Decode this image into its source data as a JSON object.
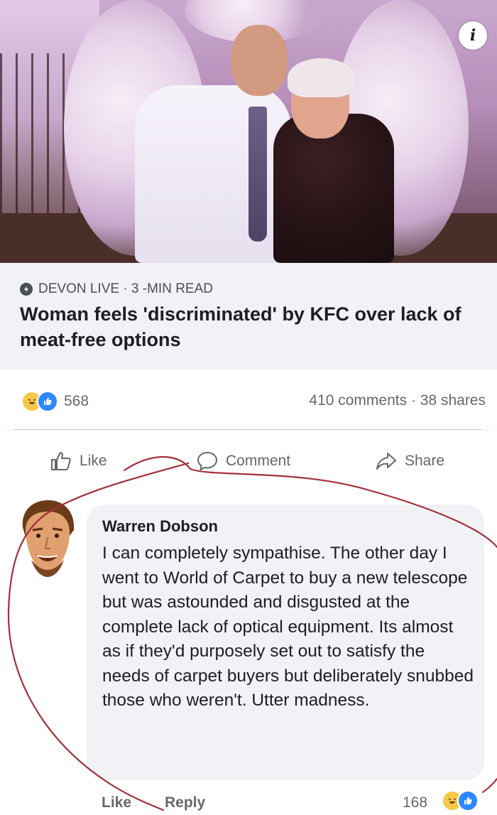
{
  "post": {
    "source": "DEVON LIVE · 3 -MIN READ",
    "headline": "Woman feels 'discriminated' by KFC over lack of meat-free options",
    "reaction_count": "568",
    "comments_shares": "410 comments · 38 shares",
    "info_icon_label": "i"
  },
  "actions": {
    "like": "Like",
    "comment": "Comment",
    "share": "Share"
  },
  "comment": {
    "author": "Warren Dobson",
    "text": "I can completely sympathise. The other day I went to World of Carpet to buy a new telescope but was astounded and disgusted at the complete lack of optical equipment. Its almost as if they'd purposely set out to satisfy the needs of carpet buyers but deliberately snubbed those who weren't. Utter madness.",
    "like_label": "Like",
    "reply_label": "Reply",
    "reaction_count": "168"
  },
  "icons": [
    "info-icon",
    "source-icon",
    "haha-reaction-icon",
    "like-reaction-icon",
    "thumbs-up-icon",
    "comment-icon",
    "share-arrow-icon"
  ],
  "colors": {
    "background": "#f0f2f5",
    "card": "#ffffff",
    "secondary_text": "#65676b",
    "like_blue": "#2d88ff",
    "haha_yellow": "#f7c84a",
    "annotation_red": "#a0303a"
  }
}
